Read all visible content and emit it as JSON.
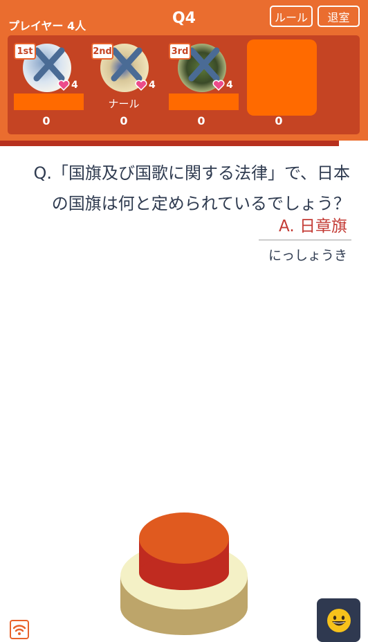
{
  "header": {
    "players_count": "プレイヤー 4人",
    "question_number": "Q4",
    "rule_button": "ルール",
    "exit_button": "退室"
  },
  "players": [
    {
      "rank": "1st",
      "lives": "4",
      "name": "",
      "score": "0"
    },
    {
      "rank": "2nd",
      "lives": "4",
      "name": "ナール",
      "score": "0"
    },
    {
      "rank": "3rd",
      "lives": "4",
      "name": "",
      "score": "0"
    },
    {
      "rank": "",
      "lives": "",
      "name": "",
      "score": "0"
    }
  ],
  "question": {
    "text": "Q.「国旗及び国歌に関する法律」で、日本の国旗は何と定められているでしょう？",
    "answer": "A. 日章旗",
    "reading": "にっしょうき"
  },
  "icons": {
    "cross": "cross-mark-icon",
    "heart": "heart-icon",
    "wifi": "wifi-icon",
    "emoji": "smiley-face-icon"
  },
  "colors": {
    "header": "#ea6d2f",
    "panel": "#c54423",
    "answer": "#c33a34",
    "buzzer_top": "#e05a1f",
    "buzzer_side": "#c02b20"
  }
}
